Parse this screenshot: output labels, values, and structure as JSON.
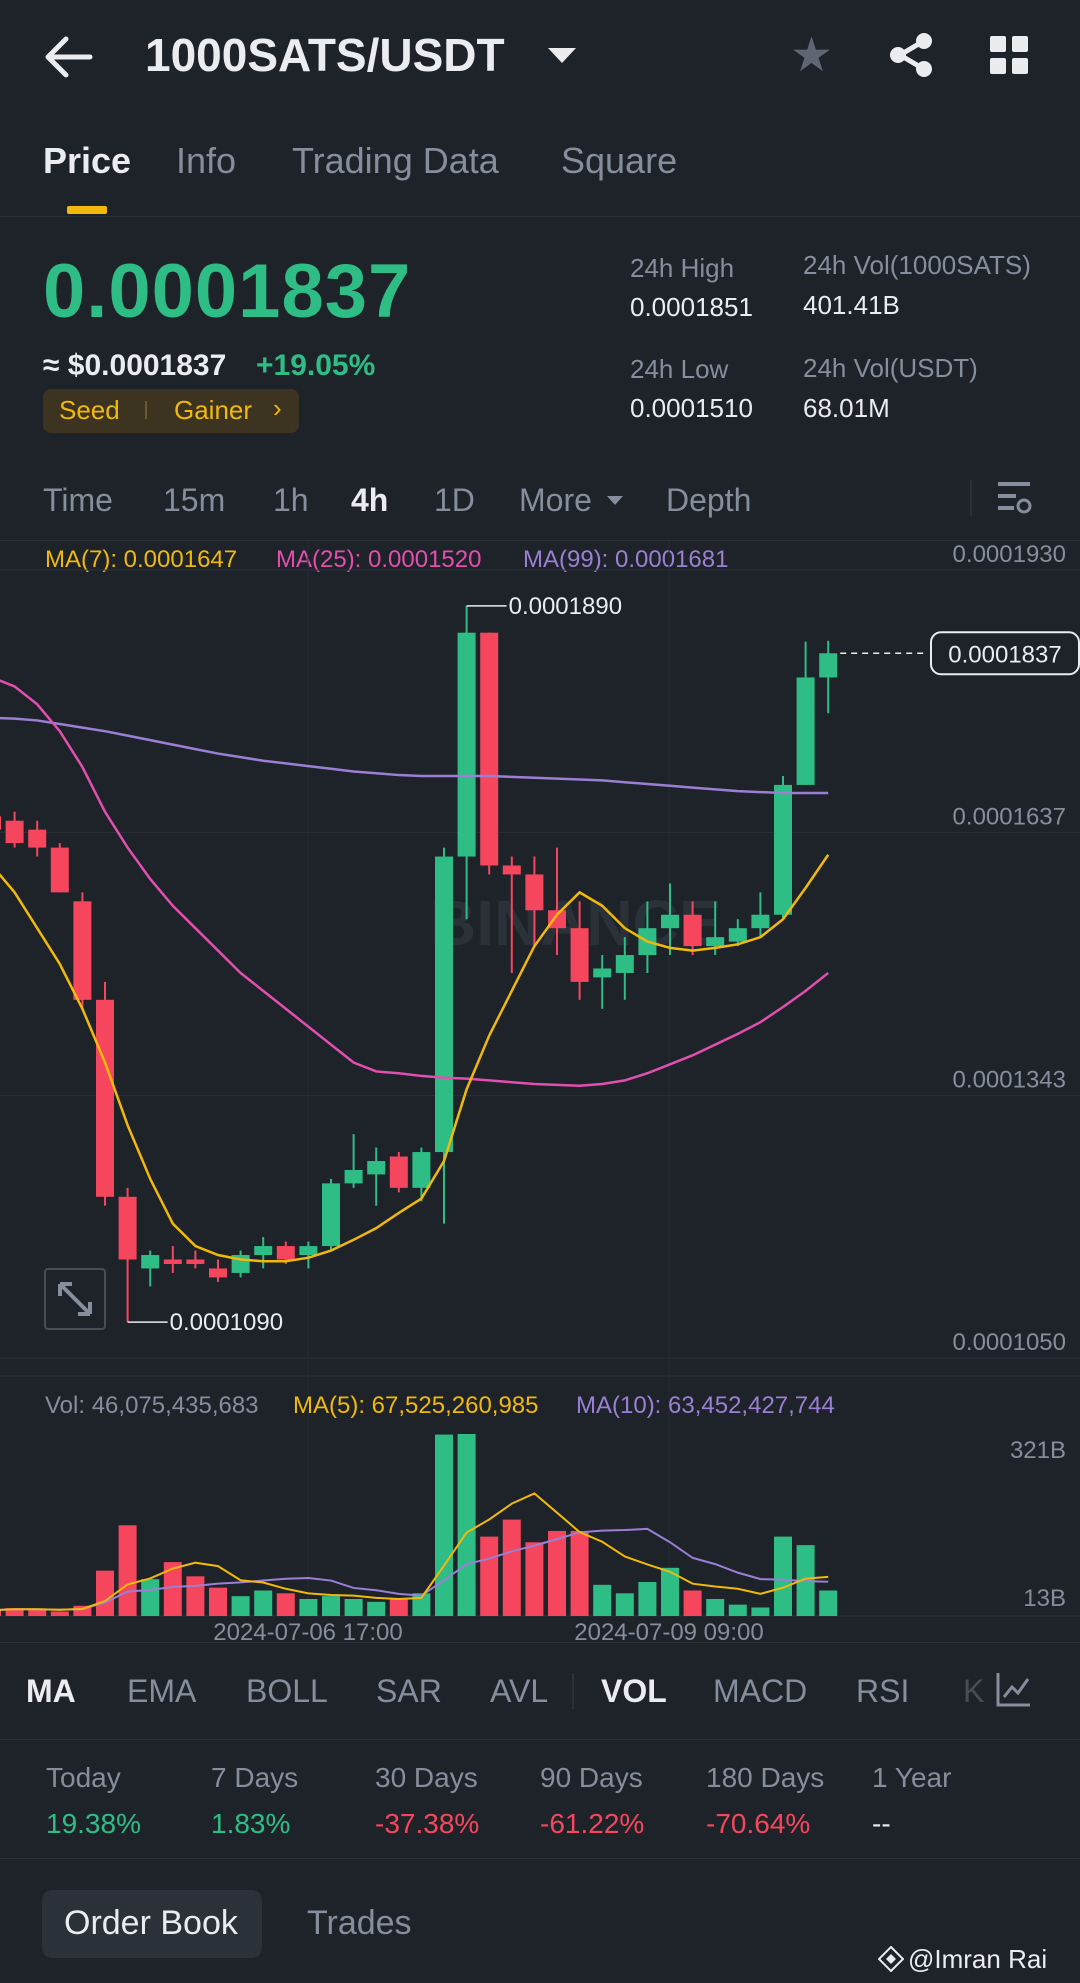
{
  "header": {
    "pair": "1000SATS/USDT"
  },
  "tabs": [
    "Price",
    "Info",
    "Trading Data",
    "Square"
  ],
  "price": {
    "last": "0.0001837",
    "usd": "≈ $0.0001837",
    "change": "+19.05%",
    "tags": [
      "Seed",
      "Gainer"
    ]
  },
  "stats": {
    "high_label": "24h High",
    "high": "0.0001851",
    "low_label": "24h Low",
    "low": "0.0001510",
    "vol_base_label": "24h Vol(1000SATS)",
    "vol_base": "401.41B",
    "vol_quote_label": "24h Vol(USDT)",
    "vol_quote": "68.01M"
  },
  "intervals": [
    "Time",
    "15m",
    "1h",
    "4h",
    "1D",
    "More",
    "Depth"
  ],
  "active_interval": "4h",
  "ma_legend": {
    "ma7": "MA(7): 0.0001647",
    "ma25": "MA(25): 0.0001520",
    "ma99": "MA(99): 0.0001681"
  },
  "vol_legend": {
    "vol": "Vol: 46,075,435,683",
    "ma5": "MA(5): 67,525,260,985",
    "ma10": "MA(10): 63,452,427,744"
  },
  "chart_data": {
    "type": "candlestick",
    "price_axis_ticks": [
      "0.0001930",
      "0.0001637",
      "0.0001343",
      "0.0001050"
    ],
    "price_ticks_values": [
      0.000193,
      0.0001637,
      0.0001343,
      0.000105
    ],
    "ylim": [
      0.000105,
      0.000193
    ],
    "current_price_label": "0.0001837",
    "current_price": 0.0001837,
    "high_marker": {
      "label": "0.0001890",
      "value": 0.000189
    },
    "low_marker": {
      "label": "0.0001090",
      "value": 0.000109
    },
    "volume_axis_ticks": [
      "321B",
      "13B"
    ],
    "time_labels": [
      "2024-07-06 17:00",
      "2024-07-09 09:00"
    ],
    "candles": [
      [
        0.0001655,
        0.000166,
        0.000162,
        0.000164
      ],
      [
        0.000165,
        0.000166,
        0.000162,
        0.0001625
      ],
      [
        0.000164,
        0.000165,
        0.000161,
        0.000162
      ],
      [
        0.000162,
        0.0001625,
        0.000157,
        0.000157
      ],
      [
        0.000156,
        0.000157,
        0.000144,
        0.000145
      ],
      [
        0.000145,
        0.000147,
        0.000122,
        0.000123
      ],
      [
        0.000123,
        0.000124,
        0.000109,
        0.000116
      ],
      [
        0.000115,
        0.000117,
        0.000113,
        0.0001165
      ],
      [
        0.000116,
        0.0001175,
        0.0001145,
        0.0001155
      ],
      [
        0.000116,
        0.000117,
        0.000115,
        0.0001155
      ],
      [
        0.000115,
        0.000116,
        0.0001135,
        0.000114
      ],
      [
        0.0001145,
        0.000117,
        0.000114,
        0.0001165
      ],
      [
        0.0001165,
        0.0001185,
        0.000115,
        0.0001175
      ],
      [
        0.0001175,
        0.000118,
        0.0001155,
        0.000116
      ],
      [
        0.0001165,
        0.000118,
        0.000115,
        0.0001175
      ],
      [
        0.0001175,
        0.000125,
        0.000117,
        0.0001245
      ],
      [
        0.0001245,
        0.00013,
        0.000124,
        0.000126
      ],
      [
        0.0001255,
        0.0001285,
        0.000122,
        0.000127
      ],
      [
        0.0001275,
        0.000128,
        0.0001235,
        0.000124
      ],
      [
        0.000124,
        0.0001285,
        0.0001225,
        0.000128
      ],
      [
        0.000128,
        0.000162,
        0.00012,
        0.000161
      ],
      [
        0.000161,
        0.000189,
        0.000154,
        0.000186
      ],
      [
        0.000186,
        0.000186,
        0.000159,
        0.00016
      ],
      [
        0.00016,
        0.000161,
        0.000148,
        0.000159
      ],
      [
        0.000159,
        0.000161,
        0.000151,
        0.000155
      ],
      [
        0.000155,
        0.000162,
        0.00015,
        0.000153
      ],
      [
        0.000153,
        0.000156,
        0.000145,
        0.000147
      ],
      [
        0.0001475,
        0.00015,
        0.000144,
        0.0001485
      ],
      [
        0.000148,
        0.000152,
        0.000145,
        0.00015
      ],
      [
        0.00015,
        0.000156,
        0.000148,
        0.000153
      ],
      [
        0.000153,
        0.000158,
        0.00015,
        0.0001545
      ],
      [
        0.0001545,
        0.000156,
        0.00015,
        0.000151
      ],
      [
        0.000151,
        0.000156,
        0.00015,
        0.000152
      ],
      [
        0.0001515,
        0.000154,
        0.000151,
        0.000153
      ],
      [
        0.000153,
        0.000157,
        0.000152,
        0.0001545
      ],
      [
        0.0001545,
        0.00017,
        0.000154,
        0.000169
      ],
      [
        0.000169,
        0.000185,
        0.000169,
        0.000181
      ],
      [
        0.000181,
        0.0001851,
        0.000177,
        0.0001837
      ]
    ],
    "volumes": [
      10,
      14,
      12,
      8,
      18,
      80,
      160,
      65,
      95,
      70,
      50,
      35,
      45,
      40,
      30,
      35,
      30,
      25,
      30,
      40,
      320,
      321,
      140,
      170,
      130,
      150,
      150,
      55,
      40,
      60,
      85,
      45,
      30,
      20,
      15,
      140,
      125,
      45
    ],
    "ma7": [
      0.00016,
      0.000157,
      0.000153,
      0.000149,
      0.000144,
      0.000138,
      0.000131,
      0.000125,
      0.00012,
      0.0001175,
      0.0001165,
      0.000116,
      0.0001158,
      0.0001158,
      0.0001162,
      0.000117,
      0.0001182,
      0.0001195,
      0.0001212,
      0.0001228,
      0.000127,
      0.000135,
      0.000141,
      0.000146,
      0.000151,
      0.0001545,
      0.000157,
      0.0001555,
      0.000153,
      0.0001515,
      0.0001508,
      0.0001505,
      0.0001508,
      0.0001512,
      0.000152,
      0.000154,
      0.0001575,
      0.0001612
    ],
    "ma25": [
      0.000181,
      0.00018,
      0.000178,
      0.000175,
      0.000171,
      0.000166,
      0.000162,
      0.0001585,
      0.0001555,
      0.000153,
      0.0001505,
      0.000148,
      0.000146,
      0.000144,
      0.000142,
      0.00014,
      0.000138,
      0.000137,
      0.0001368,
      0.0001365,
      0.0001363,
      0.0001362,
      0.000136,
      0.0001358,
      0.0001356,
      0.0001355,
      0.0001354,
      0.0001356,
      0.000136,
      0.0001368,
      0.0001378,
      0.0001388,
      0.00014,
      0.0001412,
      0.0001425,
      0.0001442,
      0.000146,
      0.000148
    ],
    "ma99": [
      0.0001765,
      0.0001764,
      0.0001762,
      0.0001758,
      0.0001754,
      0.000175,
      0.0001745,
      0.000174,
      0.0001735,
      0.000173,
      0.0001725,
      0.0001721,
      0.0001717,
      0.0001714,
      0.0001711,
      0.0001708,
      0.0001705,
      0.0001703,
      0.0001701,
      0.00017,
      0.00017,
      0.00017,
      0.00017,
      0.0001699,
      0.0001698,
      0.0001697,
      0.0001696,
      0.0001695,
      0.0001693,
      0.0001691,
      0.0001689,
      0.0001687,
      0.0001685,
      0.0001683,
      0.0001682,
      0.0001681,
      0.0001681,
      0.0001681
    ]
  },
  "indicators": [
    "MA",
    "EMA",
    "BOLL",
    "SAR",
    "AVL",
    "VOL",
    "MACD",
    "RSI",
    "K"
  ],
  "active_indicators": [
    "MA",
    "VOL"
  ],
  "performance": [
    {
      "label": "Today",
      "value": "19.38%",
      "dir": "up"
    },
    {
      "label": "7 Days",
      "value": "1.83%",
      "dir": "up"
    },
    {
      "label": "30 Days",
      "value": "-37.38%",
      "dir": "down"
    },
    {
      "label": "90 Days",
      "value": "-61.22%",
      "dir": "down"
    },
    {
      "label": "180 Days",
      "value": "-70.64%",
      "dir": "down"
    },
    {
      "label": "1 Year",
      "value": "--",
      "dir": "none"
    }
  ],
  "bottom": {
    "order_book": "Order Book",
    "trades": "Trades",
    "watermark": "@Imran Rai"
  },
  "colors": {
    "up": "#2ebd85",
    "down": "#f6465d",
    "ma7": "#f0b90b",
    "ma25": "#e24fb0",
    "ma99": "#9b7fd4",
    "accent": "#f0b90b",
    "background": "#1e2329"
  },
  "watermark_logo": "BINANCE"
}
